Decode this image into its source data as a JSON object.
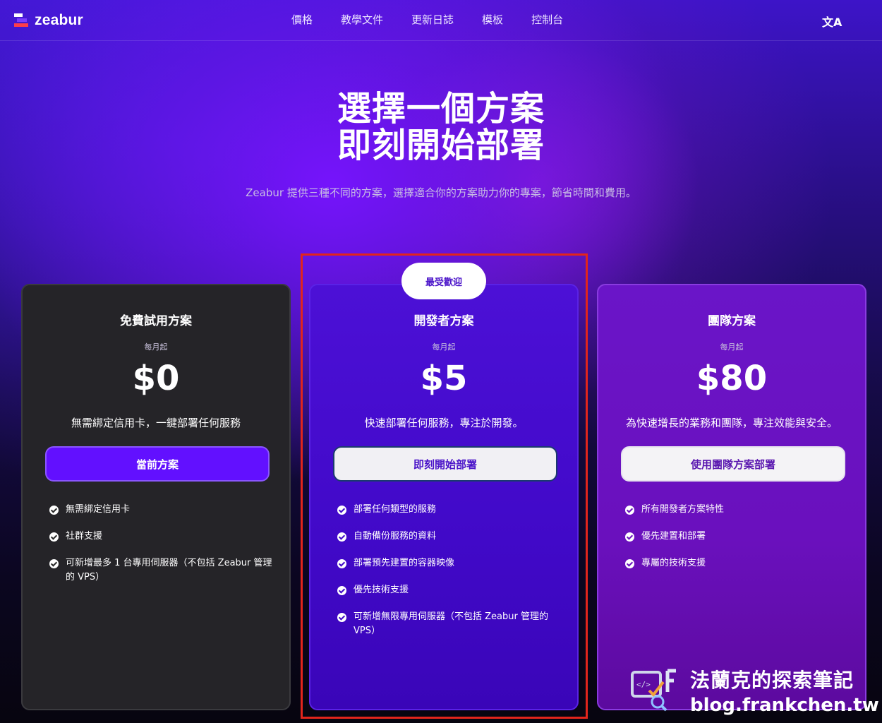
{
  "brand": {
    "name": "zeabur"
  },
  "nav": {
    "links": [
      "價格",
      "教學文件",
      "更新日誌",
      "模板",
      "控制台"
    ],
    "translate_icon": "translate-icon"
  },
  "hero": {
    "title_line1": "選擇一個方案",
    "title_line2": "即刻開始部署",
    "subtitle": "Zeabur 提供三種不同的方案，選擇適合你的方案助力你的專案，節省時間和費用。"
  },
  "badge": "最受歡迎",
  "plans": [
    {
      "name": "免費試用方案",
      "per": "每月起",
      "price": "$0",
      "desc": "無需綁定信用卡，一鍵部署任何服務",
      "cta": "當前方案",
      "features": [
        "無需綁定信用卡",
        "社群支援",
        "可新增最多 1 台專用伺服器（不包括 Zeabur 管理的 VPS）"
      ]
    },
    {
      "name": "開發者方案",
      "per": "每月起",
      "price": "$5",
      "desc": "快速部署任何服務，專注於開發。",
      "cta": "即刻開始部署",
      "features": [
        "部署任何類型的服務",
        "自動備份服務的資料",
        "部署預先建置的容器映像",
        "優先技術支援",
        "可新增無限專用伺服器（不包括 Zeabur 管理的 VPS）"
      ]
    },
    {
      "name": "團隊方案",
      "per": "每月起",
      "price": "$80",
      "desc": "為快速增長的業務和團隊，專注效能與安全。",
      "cta": "使用團隊方案部署",
      "features": [
        "所有開發者方案特性",
        "優先建置和部署",
        "專屬的技術支援"
      ]
    }
  ],
  "watermark": {
    "line1": "法蘭克的探索筆記",
    "line2": "blog.frankchen.tw"
  },
  "colors": {
    "accent": "#6210ff",
    "highlight_frame": "#e2251c"
  }
}
